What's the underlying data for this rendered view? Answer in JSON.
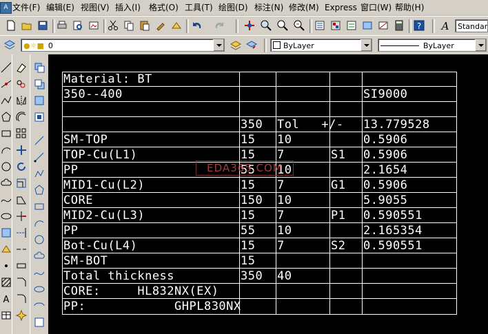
{
  "menu": [
    {
      "id": "file",
      "label": "文件(F)"
    },
    {
      "id": "edit",
      "label": "编辑(E)"
    },
    {
      "id": "view",
      "label": "视图(V)"
    },
    {
      "id": "insert",
      "label": "插入(I)"
    },
    {
      "id": "format",
      "label": "格式(O)"
    },
    {
      "id": "tools",
      "label": "工具(T)"
    },
    {
      "id": "draw",
      "label": "绘图(D)"
    },
    {
      "id": "dimension",
      "label": "标注(N)"
    },
    {
      "id": "modify",
      "label": "修改(M)"
    },
    {
      "id": "express",
      "label": "Express"
    },
    {
      "id": "window",
      "label": "窗口(W)"
    },
    {
      "id": "help",
      "label": "帮助(H)"
    }
  ],
  "toolbar": {
    "text_style": "Standar",
    "layer": "0",
    "color": "ByLayer",
    "linetype": "ByLayer"
  },
  "colors": {
    "canvas": "#000000",
    "lines": "#ffffff",
    "ui": "#d4d0c8",
    "watermark": "#c04848"
  },
  "watermark": "EDA365.COM",
  "table": {
    "rows": [
      {
        "c1": "Material: BT",
        "c2": "",
        "c3": "",
        "c4": "",
        "c5": ""
      },
      {
        "c1": "350--400",
        "c2": "",
        "c3": "",
        "c4": "",
        "c5": "SI9000"
      },
      {
        "c1": "",
        "c2": "",
        "c3": "",
        "c4": "",
        "c5": ""
      },
      {
        "c1": "",
        "c2": "350",
        "c3": "Tol   +/-",
        "c4": "",
        "c5": "13.779528"
      },
      {
        "c1": "SM-TOP",
        "c2": "15",
        "c3": "10",
        "c4": "",
        "c5": "0.5906"
      },
      {
        "c1": "TOP-Cu(L1)",
        "c2": "15",
        "c3": "7",
        "c4": "S1",
        "c5": "0.5906"
      },
      {
        "c1": "PP",
        "c2": "55",
        "c3": "10",
        "c4": "",
        "c5": "2.1654"
      },
      {
        "c1": "MID1-Cu(L2)",
        "c2": "15",
        "c3": "7",
        "c4": "G1",
        "c5": "0.5906"
      },
      {
        "c1": "CORE",
        "c2": "150",
        "c3": "10",
        "c4": "",
        "c5": "5.9055"
      },
      {
        "c1": "MID2-Cu(L3)",
        "c2": "15",
        "c3": "7",
        "c4": "P1",
        "c5": "0.590551"
      },
      {
        "c1": "PP",
        "c2": "55",
        "c3": "10",
        "c4": "",
        "c5": "2.165354"
      },
      {
        "c1": "Bot-Cu(L4)",
        "c2": "15",
        "c3": "7",
        "c4": "S2",
        "c5": "0.590551"
      },
      {
        "c1": "SM-BOT",
        "c2": "15",
        "c3": "",
        "c4": "",
        "c5": ""
      },
      {
        "c1": "Total thickness",
        "c2": "350",
        "c3": "40",
        "c4": "",
        "c5": ""
      },
      {
        "c1": "CORE:     HL832NX(EX)",
        "c2": "",
        "c3": "",
        "c4": "",
        "c5": ""
      },
      {
        "c1": "PP:            GHPL830NX",
        "c2": "",
        "c3": "",
        "c4": "",
        "c5": ""
      }
    ]
  }
}
